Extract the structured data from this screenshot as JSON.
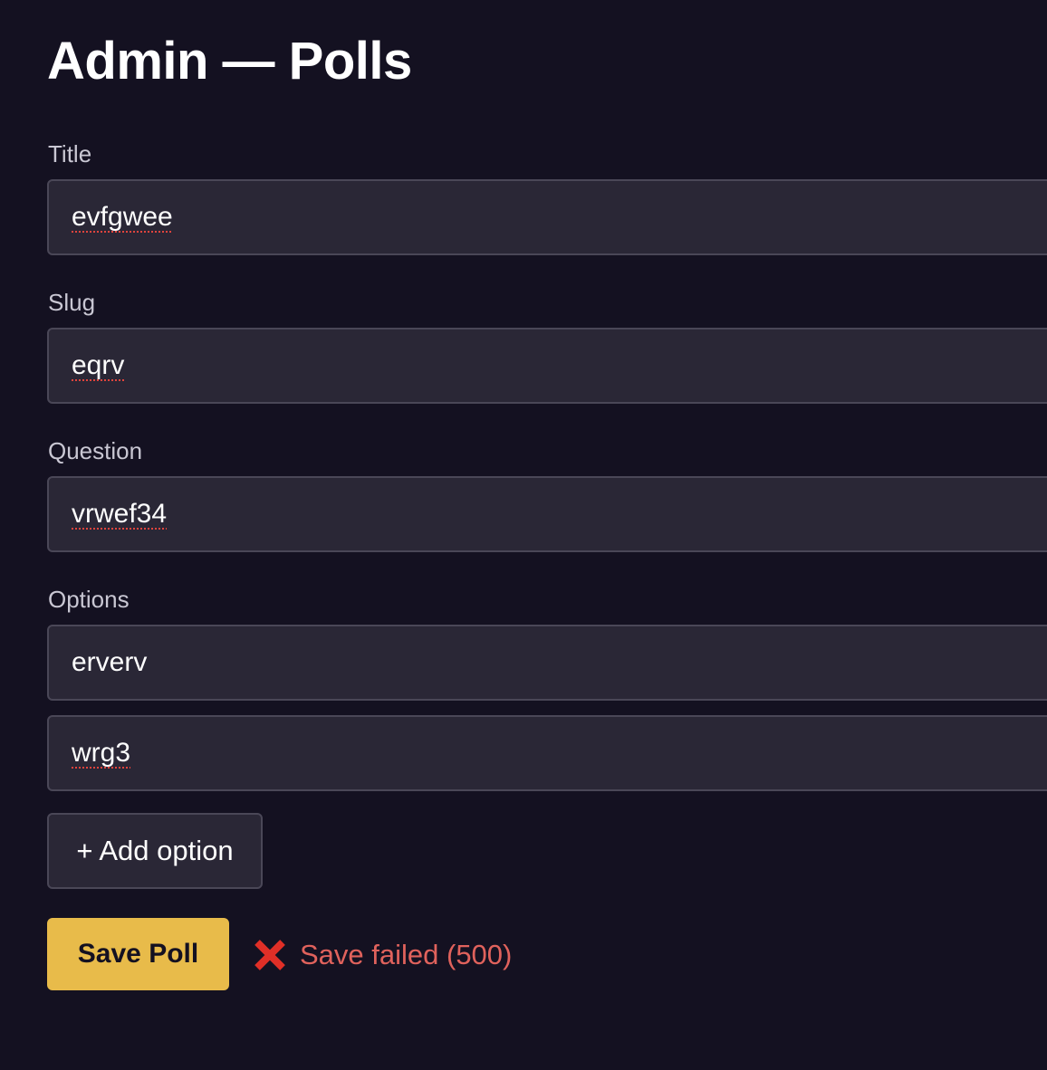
{
  "page": {
    "title": "Admin — Polls"
  },
  "form": {
    "title": {
      "label": "Title",
      "value": "evfgwee"
    },
    "slug": {
      "label": "Slug",
      "value": "eqrv"
    },
    "question": {
      "label": "Question",
      "value": "vrwef34"
    },
    "options": {
      "label": "Options",
      "items": [
        {
          "value": "erverv"
        },
        {
          "value": "wrg3"
        }
      ]
    },
    "add_option_label": "+ Add option",
    "save_label": "Save Poll"
  },
  "status": {
    "icon": "cross-mark-icon",
    "text": "Save failed (500)",
    "color": "#e0625c"
  },
  "colors": {
    "background": "#141121",
    "input_background": "#2a2736",
    "input_border": "#4a4757",
    "accent": "#e8bb4a",
    "error": "#e0625c"
  }
}
